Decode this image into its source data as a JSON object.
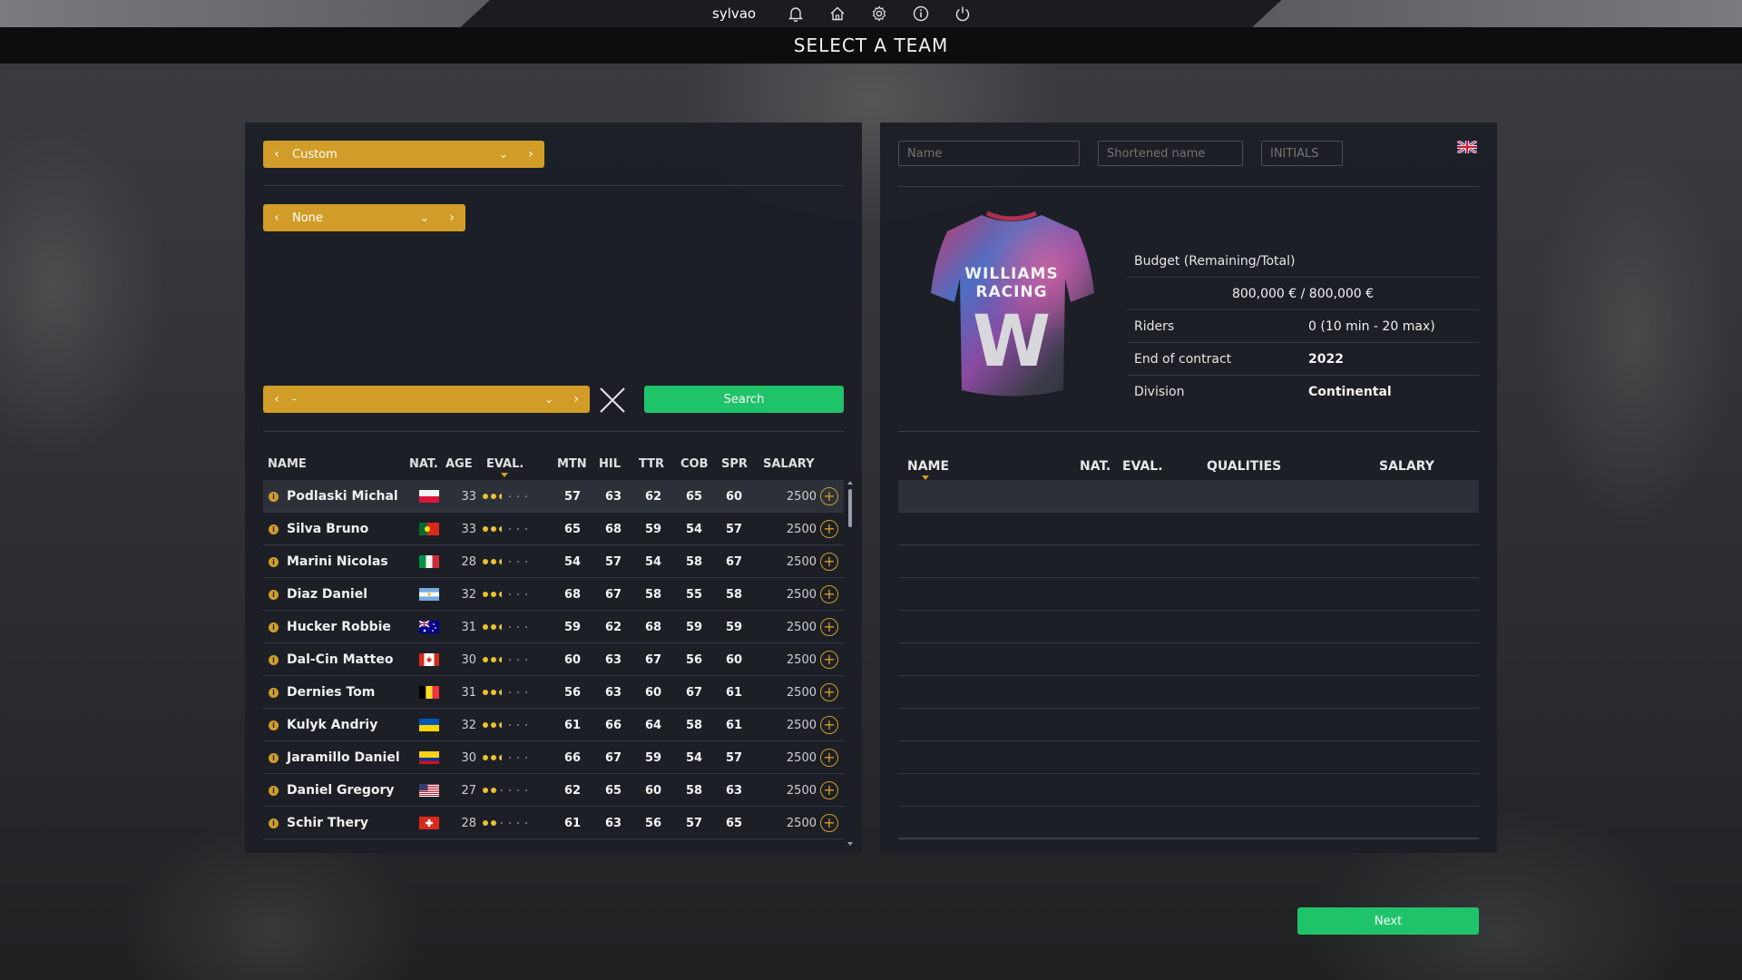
{
  "topbar": {
    "username": "sylvao",
    "icons": [
      "bell-icon",
      "home-icon",
      "gear-icon",
      "info-icon",
      "power-icon"
    ]
  },
  "title": "SELECT A TEAM",
  "left": {
    "dropdown_team": "Custom",
    "dropdown_filter": "None",
    "dropdown_search": "-",
    "search_label": "Search",
    "columns": {
      "name": "NAME",
      "nat": "NAT.",
      "age": "AGE",
      "eval": "EVAL.",
      "mtn": "MTN",
      "hil": "HIL",
      "ttr": "TTR",
      "cob": "COB",
      "spr": "SPR",
      "salary": "SALARY"
    },
    "riders": [
      {
        "name": "Podlaski Michal",
        "nat": "poland",
        "age": "33",
        "eval": 2.5,
        "mtn": "57",
        "hil": "63",
        "ttr": "62",
        "cob": "65",
        "spr": "60",
        "salary": "2500"
      },
      {
        "name": "Silva Bruno",
        "nat": "portugal",
        "age": "33",
        "eval": 2.5,
        "mtn": "65",
        "hil": "68",
        "ttr": "59",
        "cob": "54",
        "spr": "57",
        "salary": "2500"
      },
      {
        "name": "Marini Nicolas",
        "nat": "italy",
        "age": "28",
        "eval": 2.5,
        "mtn": "54",
        "hil": "57",
        "ttr": "54",
        "cob": "58",
        "spr": "67",
        "salary": "2500"
      },
      {
        "name": "Diaz Daniel",
        "nat": "argentina",
        "age": "32",
        "eval": 2.5,
        "mtn": "68",
        "hil": "67",
        "ttr": "58",
        "cob": "55",
        "spr": "58",
        "salary": "2500"
      },
      {
        "name": "Hucker Robbie",
        "nat": "australia",
        "age": "31",
        "eval": 2.5,
        "mtn": "59",
        "hil": "62",
        "ttr": "68",
        "cob": "59",
        "spr": "59",
        "salary": "2500"
      },
      {
        "name": "Dal-Cin Matteo",
        "nat": "canada",
        "age": "30",
        "eval": 2.5,
        "mtn": "60",
        "hil": "63",
        "ttr": "67",
        "cob": "56",
        "spr": "60",
        "salary": "2500"
      },
      {
        "name": "Dernies Tom",
        "nat": "belgium",
        "age": "31",
        "eval": 2.5,
        "mtn": "56",
        "hil": "63",
        "ttr": "60",
        "cob": "67",
        "spr": "61",
        "salary": "2500"
      },
      {
        "name": "Kulyk Andriy",
        "nat": "ukraine",
        "age": "32",
        "eval": 2.5,
        "mtn": "61",
        "hil": "66",
        "ttr": "64",
        "cob": "58",
        "spr": "61",
        "salary": "2500"
      },
      {
        "name": "Jaramillo Daniel",
        "nat": "colombia",
        "age": "30",
        "eval": 2.5,
        "mtn": "66",
        "hil": "67",
        "ttr": "59",
        "cob": "54",
        "spr": "57",
        "salary": "2500"
      },
      {
        "name": "Daniel Gregory",
        "nat": "usa",
        "age": "27",
        "eval": 2,
        "mtn": "62",
        "hil": "65",
        "ttr": "60",
        "cob": "58",
        "spr": "63",
        "salary": "2500"
      },
      {
        "name": "Schir Thery",
        "nat": "switzerland",
        "age": "28",
        "eval": 2,
        "mtn": "61",
        "hil": "63",
        "ttr": "56",
        "cob": "57",
        "spr": "65",
        "salary": "2500"
      }
    ]
  },
  "right": {
    "name_placeholder": "Name",
    "short_placeholder": "Shortened name",
    "initials_placeholder": "INITIALS",
    "jersey_text_1": "WILLIAMS",
    "jersey_text_2": "RACING",
    "jersey_letter": "W",
    "budget_label": "Budget (Remaining/Total)",
    "budget_value": "800,000 € / 800,000 €",
    "riders_label": "Riders",
    "riders_value": "0 (10 min - 20 max)",
    "contract_label": "End of contract",
    "contract_value": "2022",
    "division_label": "Division",
    "division_value": "Continental",
    "columns": {
      "name": "NAME",
      "nat": "NAT.",
      "eval": "EVAL.",
      "qualities": "QUALITIES",
      "salary": "SALARY"
    }
  },
  "next_label": "Next",
  "colors": {
    "accent": "#d19d28",
    "green": "#1fc46a",
    "panel": "#1c1f26"
  }
}
